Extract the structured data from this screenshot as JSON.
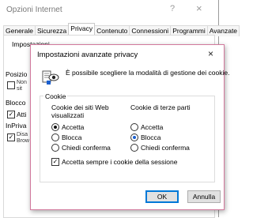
{
  "background_window": {
    "title": "Opzioni Internet",
    "help_icon": "?",
    "close_icon": "×",
    "tabs": [
      {
        "label": "Generale"
      },
      {
        "label": "Sicurezza"
      },
      {
        "label": "Privacy"
      },
      {
        "label": "Contenuto"
      },
      {
        "label": "Connessioni"
      },
      {
        "label": "Programmi"
      },
      {
        "label": "Avanzate"
      }
    ],
    "active_tab": "Privacy",
    "panel": {
      "settings_label": "Impostazioni",
      "position_label": "Posizio",
      "position_option_text": "Non",
      "position_option_text2": "sit",
      "block_label": "Blocco",
      "block_option_text": "Atti",
      "inprivate_label": "InPriva",
      "inprivate_text1": "Disa",
      "inprivate_text2": "Brow"
    }
  },
  "dialog": {
    "title": "Impostazioni avanzate privacy",
    "close_icon": "×",
    "description": "È possibile scegliere la modalità di gestione dei cookie.",
    "group_title": "Cookie",
    "first_party": {
      "heading_line1": "Cookie dei siti Web",
      "heading_line2": "visualizzati",
      "options": [
        {
          "label": "Accetta",
          "selected": true
        },
        {
          "label": "Blocca",
          "selected": false
        },
        {
          "label": "Chiedi conferma",
          "selected": false
        }
      ]
    },
    "third_party": {
      "heading": "Cookie di terze parti",
      "options": [
        {
          "label": "Accetta",
          "selected": false
        },
        {
          "label": "Blocca",
          "selected": true
        },
        {
          "label": "Chiedi conferma",
          "selected": false
        }
      ]
    },
    "session_checkbox": {
      "label": "Accetta sempre i cookie della sessione",
      "checked": true
    },
    "ok_label": "OK",
    "cancel_label": "Annulla"
  }
}
